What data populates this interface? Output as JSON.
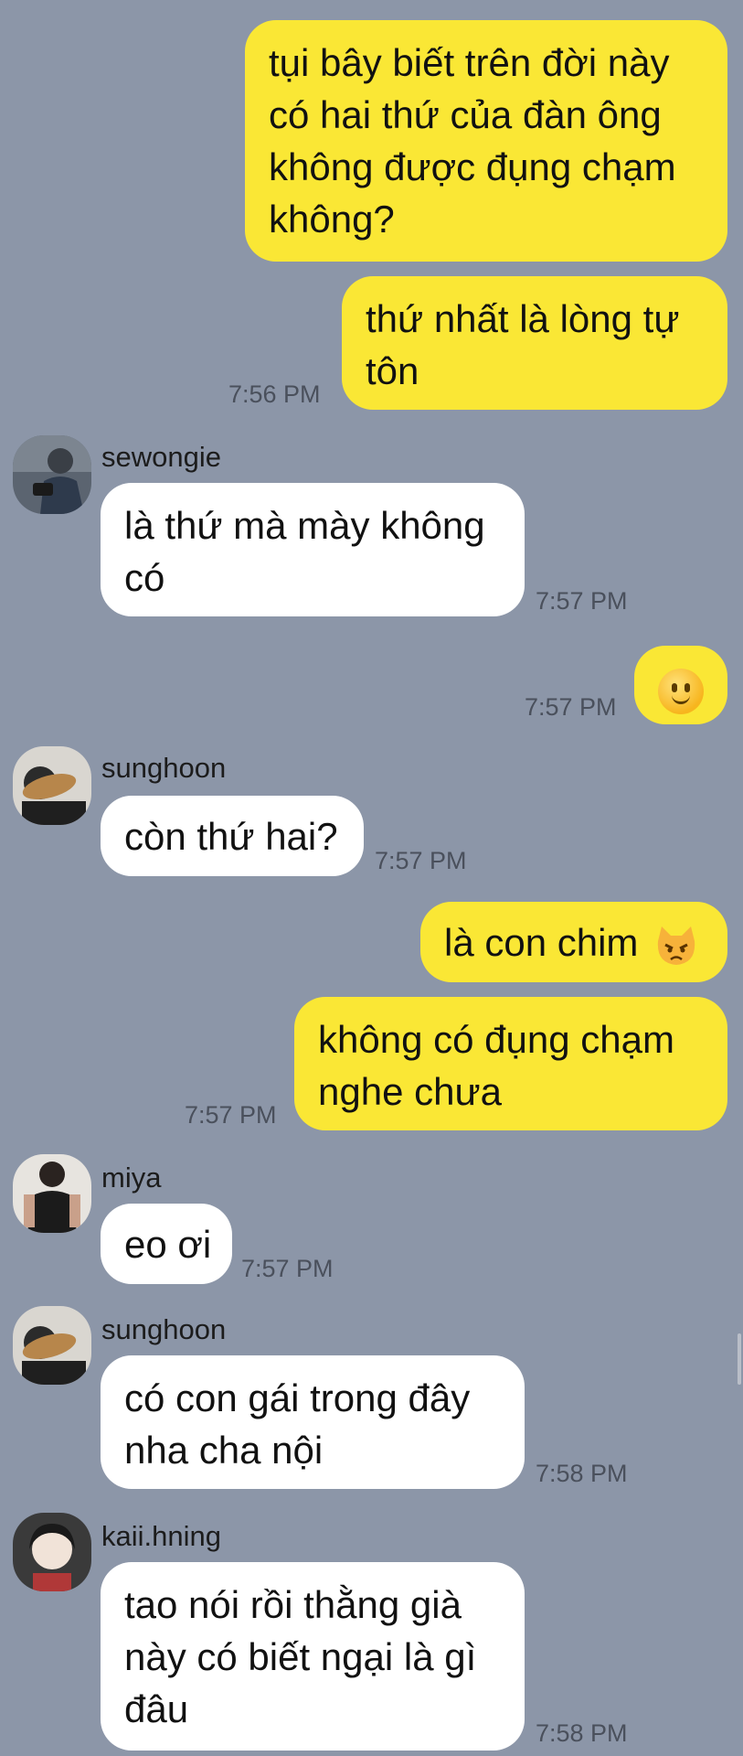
{
  "messages": [
    {
      "side": "out",
      "lines": [
        "tụi bây biết trên đời này",
        "có hai thứ của đàn ông",
        "không được đụng chạm",
        "không?"
      ]
    },
    {
      "side": "out",
      "lines": [
        "thứ nhất là lòng tự",
        "tôn"
      ],
      "time": "7:56 PM"
    },
    {
      "side": "in",
      "sender": "sewongie",
      "lines": [
        "là thứ mà mày không",
        "có"
      ],
      "time": "7:57 PM"
    },
    {
      "side": "out",
      "emoji": "slightly-smiling-face-icon",
      "time": "7:57 PM"
    },
    {
      "side": "in",
      "sender": "sunghoon",
      "lines": [
        "còn thứ hai?"
      ],
      "time": "7:57 PM"
    },
    {
      "side": "out",
      "lines": [
        "là con chim"
      ],
      "emoji": "pouting-cat-icon"
    },
    {
      "side": "out",
      "lines": [
        "không có đụng chạm",
        "nghe chưa"
      ],
      "time": "7:57 PM"
    },
    {
      "side": "in",
      "sender": "miya",
      "lines": [
        "eo ơi"
      ],
      "time": "7:57 PM"
    },
    {
      "side": "in",
      "sender": "sunghoon",
      "lines": [
        "có con gái trong đây",
        "nha cha nội"
      ],
      "time": "7:58 PM"
    },
    {
      "side": "in",
      "sender": "kaii.hning",
      "lines": [
        "tao nói rồi thằng già",
        "này có biết ngại là gì",
        "đâu"
      ],
      "time": "7:58 PM"
    }
  ],
  "colors": {
    "background": "#8c96a8",
    "outgoing": "#fae735",
    "incoming": "#ffffff"
  }
}
